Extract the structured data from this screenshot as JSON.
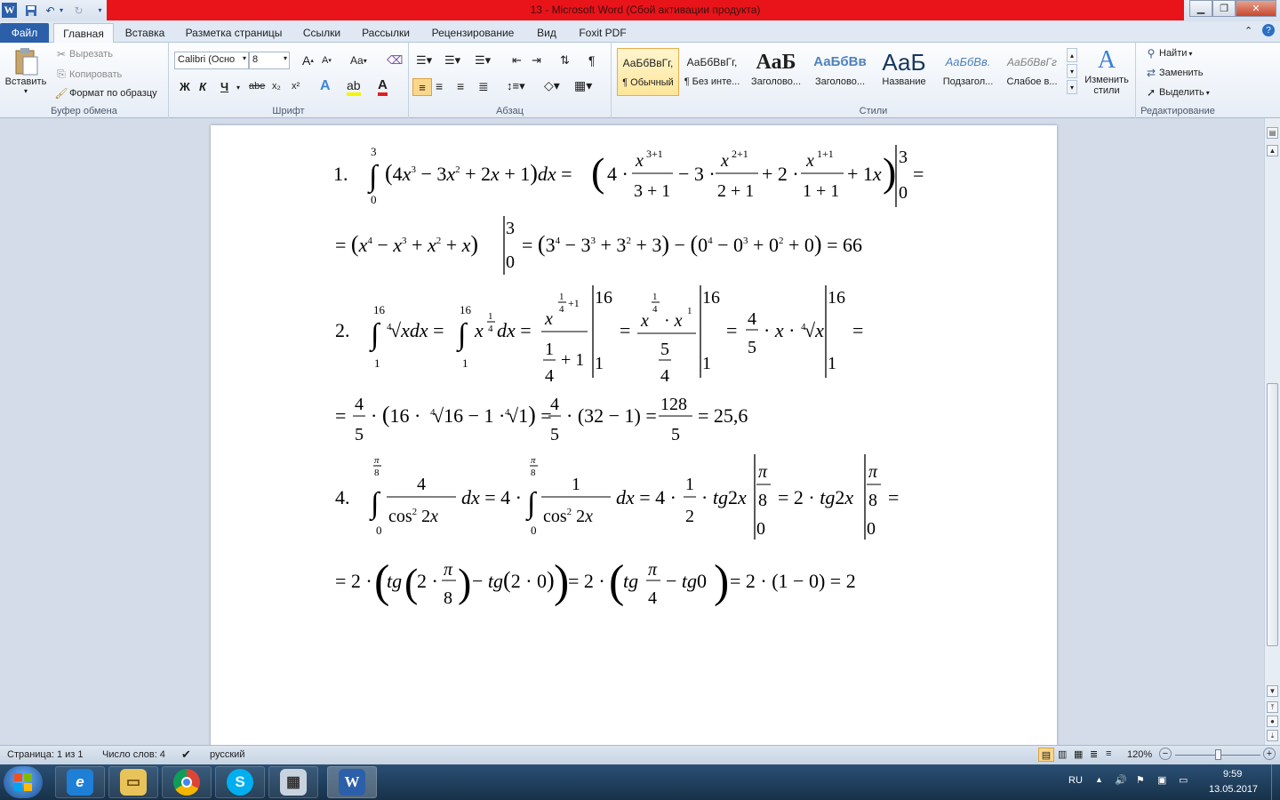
{
  "window": {
    "title": "13  -  Microsoft Word (Сбой активации продукта)",
    "word_icon_letter": "W"
  },
  "tabs": [
    {
      "label": "Файл"
    },
    {
      "label": "Главная"
    },
    {
      "label": "Вставка"
    },
    {
      "label": "Разметка страницы"
    },
    {
      "label": "Ссылки"
    },
    {
      "label": "Рассылки"
    },
    {
      "label": "Рецензирование"
    },
    {
      "label": "Вид"
    },
    {
      "label": "Foxit PDF"
    }
  ],
  "ribbon": {
    "clipboard": {
      "paste": "Вставить",
      "cut": "Вырезать",
      "copy": "Копировать",
      "format_painter": "Формат по образцу",
      "label": "Буфер обмена"
    },
    "font": {
      "font_name": "Calibri (Осно",
      "font_size": "8",
      "bold": "Ж",
      "italic": "К",
      "underline": "Ч",
      "strike": "abe",
      "subscript": "x₂",
      "superscript": "x²",
      "grow": "A",
      "shrink": "A",
      "change_case": "Aa",
      "label": "Шрифт"
    },
    "paragraph": {
      "label": "Абзац"
    },
    "styles": {
      "items": [
        {
          "preview": "АаБбВвГг,",
          "name": "¶ Обычный"
        },
        {
          "preview": "АаБбВвГг,",
          "name": "¶ Без инте..."
        },
        {
          "preview": "АаБ",
          "name": "Заголово..."
        },
        {
          "preview": "АаБбВв",
          "name": "Заголово..."
        },
        {
          "preview": "АаБ",
          "name": "Название"
        },
        {
          "preview": "АаБбВв.",
          "name": "Подзагол..."
        },
        {
          "preview": "АаБбВвГг",
          "name": "Слабое в..."
        }
      ],
      "change_styles": "Изменить стили",
      "label": "Стили"
    },
    "editing": {
      "find": "Найти",
      "replace": "Заменить",
      "select": "Выделить",
      "label": "Редактирование"
    }
  },
  "document": {
    "problem1": {
      "number": "1.",
      "lower": "0",
      "upper": "3",
      "integrand": "(4x³ − 3x² + 2x + 1)dx",
      "fractions": [
        {
          "coef": "4",
          "num": "x",
          "num_exp": "3+1",
          "den": "3 + 1"
        },
        {
          "coef": "3",
          "num": "x",
          "num_exp": "2+1",
          "den": "2 + 1"
        },
        {
          "coef": "2",
          "num": "x",
          "num_exp": "1+1",
          "den": "1 + 1"
        }
      ],
      "tail": "+ 1x",
      "line2_left": "= (x⁴ − x³ + x² + x)",
      "line2_right": "= (3⁴ − 3³ + 3² + 3) − (0⁴ − 0³ + 0² + 0) = 66"
    },
    "problem2": {
      "number": "2.",
      "lower": "1",
      "upper": "16",
      "line2": "= 16 · ⁴√16 − 1 · ⁴√1 = (32 − 1) = 25,6",
      "frac_four": "4",
      "frac_five": "5",
      "frac_128": "128"
    },
    "problem4": {
      "number": "4.",
      "upper": "π/8",
      "lower": "0",
      "line2_result": "= 2 · (1 − 0) = 2"
    }
  },
  "statusbar": {
    "page": "Страница: 1 из 1",
    "words": "Число слов: 4",
    "language": "русский",
    "zoom": "120%"
  },
  "taskbar": {
    "language": "RU",
    "time": "9:59",
    "date": "13.05.2017"
  }
}
